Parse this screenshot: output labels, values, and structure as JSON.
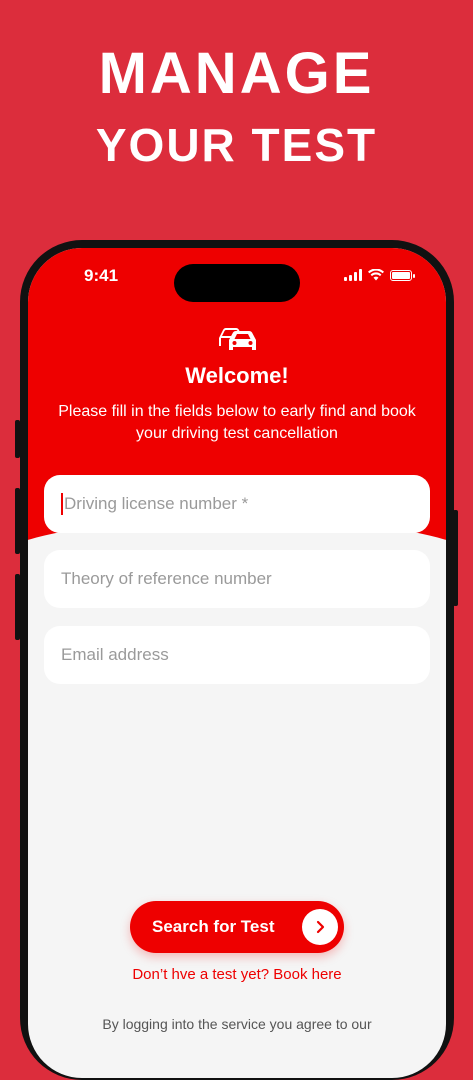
{
  "promo": {
    "line1": "MANAGE",
    "line2": "YOUR TEST"
  },
  "status_bar": {
    "time": "9:41"
  },
  "header": {
    "icon": "cars-icon",
    "title": "Welcome!",
    "subtitle": "Please fill in the fields below to early find and book your driving test cancellation"
  },
  "form": {
    "license_placeholder": "Driving license number *",
    "theory_placeholder": "Theory of reference number",
    "email_placeholder": "Email address"
  },
  "actions": {
    "search_label": "Search for Test",
    "book_link": "Don’t hve a test yet? Book here",
    "legal_text": "By logging into the service you agree to our"
  },
  "colors": {
    "background": "#dc2d3c",
    "header": "#ee0000",
    "accent": "#ee0000"
  }
}
